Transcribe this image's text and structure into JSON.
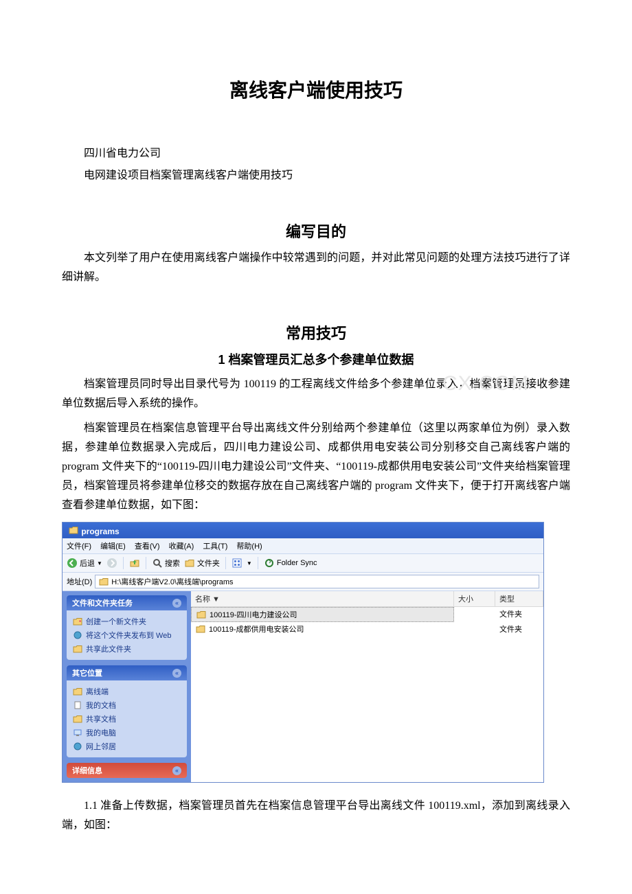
{
  "doc": {
    "title": "离线客户端使用技巧",
    "line1": "四川省电力公司",
    "line2": "电网建设项目档案管理离线客户端使用技巧",
    "h2_purpose": "编写目的",
    "para_purpose": "本文列举了用户在使用离线客户端操作中较常遇到的问题，并对此常见问题的处理方法技巧进行了详细讲解。",
    "h2_common": "常用技巧",
    "h3_section1": "1 档案管理员汇总多个参建单位数据",
    "para_s1a": "档案管理员同时导出目录代号为 100119 的工程离线文件给多个参建单位录入，档案管理员接收参建单位数据后导入系统的操作。",
    "para_s1b": "档案管理员在档案信息管理平台导出离线文件分别给两个参建单位（这里以两家单位为例）录入数据，参建单位数据录入完成后，四川电力建设公司、成都供用电安装公司分别移交自己离线客户端的 program 文件夹下的“100119-四川电力建设公司”文件夹、“100119-成都供用电安装公司”文件夹给档案管理员，档案管理员将参建单位移交的数据存放在自己离线客户端的 program 文件夹下，便于打开离线客户端查看参建单位数据，如下图：",
    "para_s1_1": "1.1 准备上传数据，档案管理员首先在档案信息管理平台导出离线文件 100119.xml，添加到离线录入端，如图：",
    "watermark": "CX.COM"
  },
  "explorer": {
    "title": "programs",
    "menu": {
      "file": "文件(F)",
      "edit": "编辑(E)",
      "view": "查看(V)",
      "fav": "收藏(A)",
      "tools": "工具(T)",
      "help": "帮助(H)"
    },
    "toolbar": {
      "back": "后退",
      "search": "搜索",
      "folders": "文件夹",
      "sync": "Folder Sync"
    },
    "address_label": "地址(D)",
    "address_path": "H:\\离线客户端V2.0\\离线端\\programs",
    "side": {
      "tasks_title": "文件和文件夹任务",
      "tasks": {
        "new": "创建一个新文件夹",
        "publish": "将这个文件夹发布到 Web",
        "share": "共享此文件夹"
      },
      "other_title": "其它位置",
      "other": {
        "offline": "离线端",
        "docs": "我的文档",
        "shared": "共享文档",
        "pc": "我的电脑",
        "net": "网上邻居"
      },
      "detail_title": "详细信息"
    },
    "list": {
      "col_name": "名称 ▼",
      "col_size": "大小",
      "col_type": "类型",
      "rows": [
        {
          "name": "100119-四川电力建设公司",
          "type": "文件夹"
        },
        {
          "name": "100119-成都供用电安装公司",
          "type": "文件夹"
        }
      ]
    }
  }
}
